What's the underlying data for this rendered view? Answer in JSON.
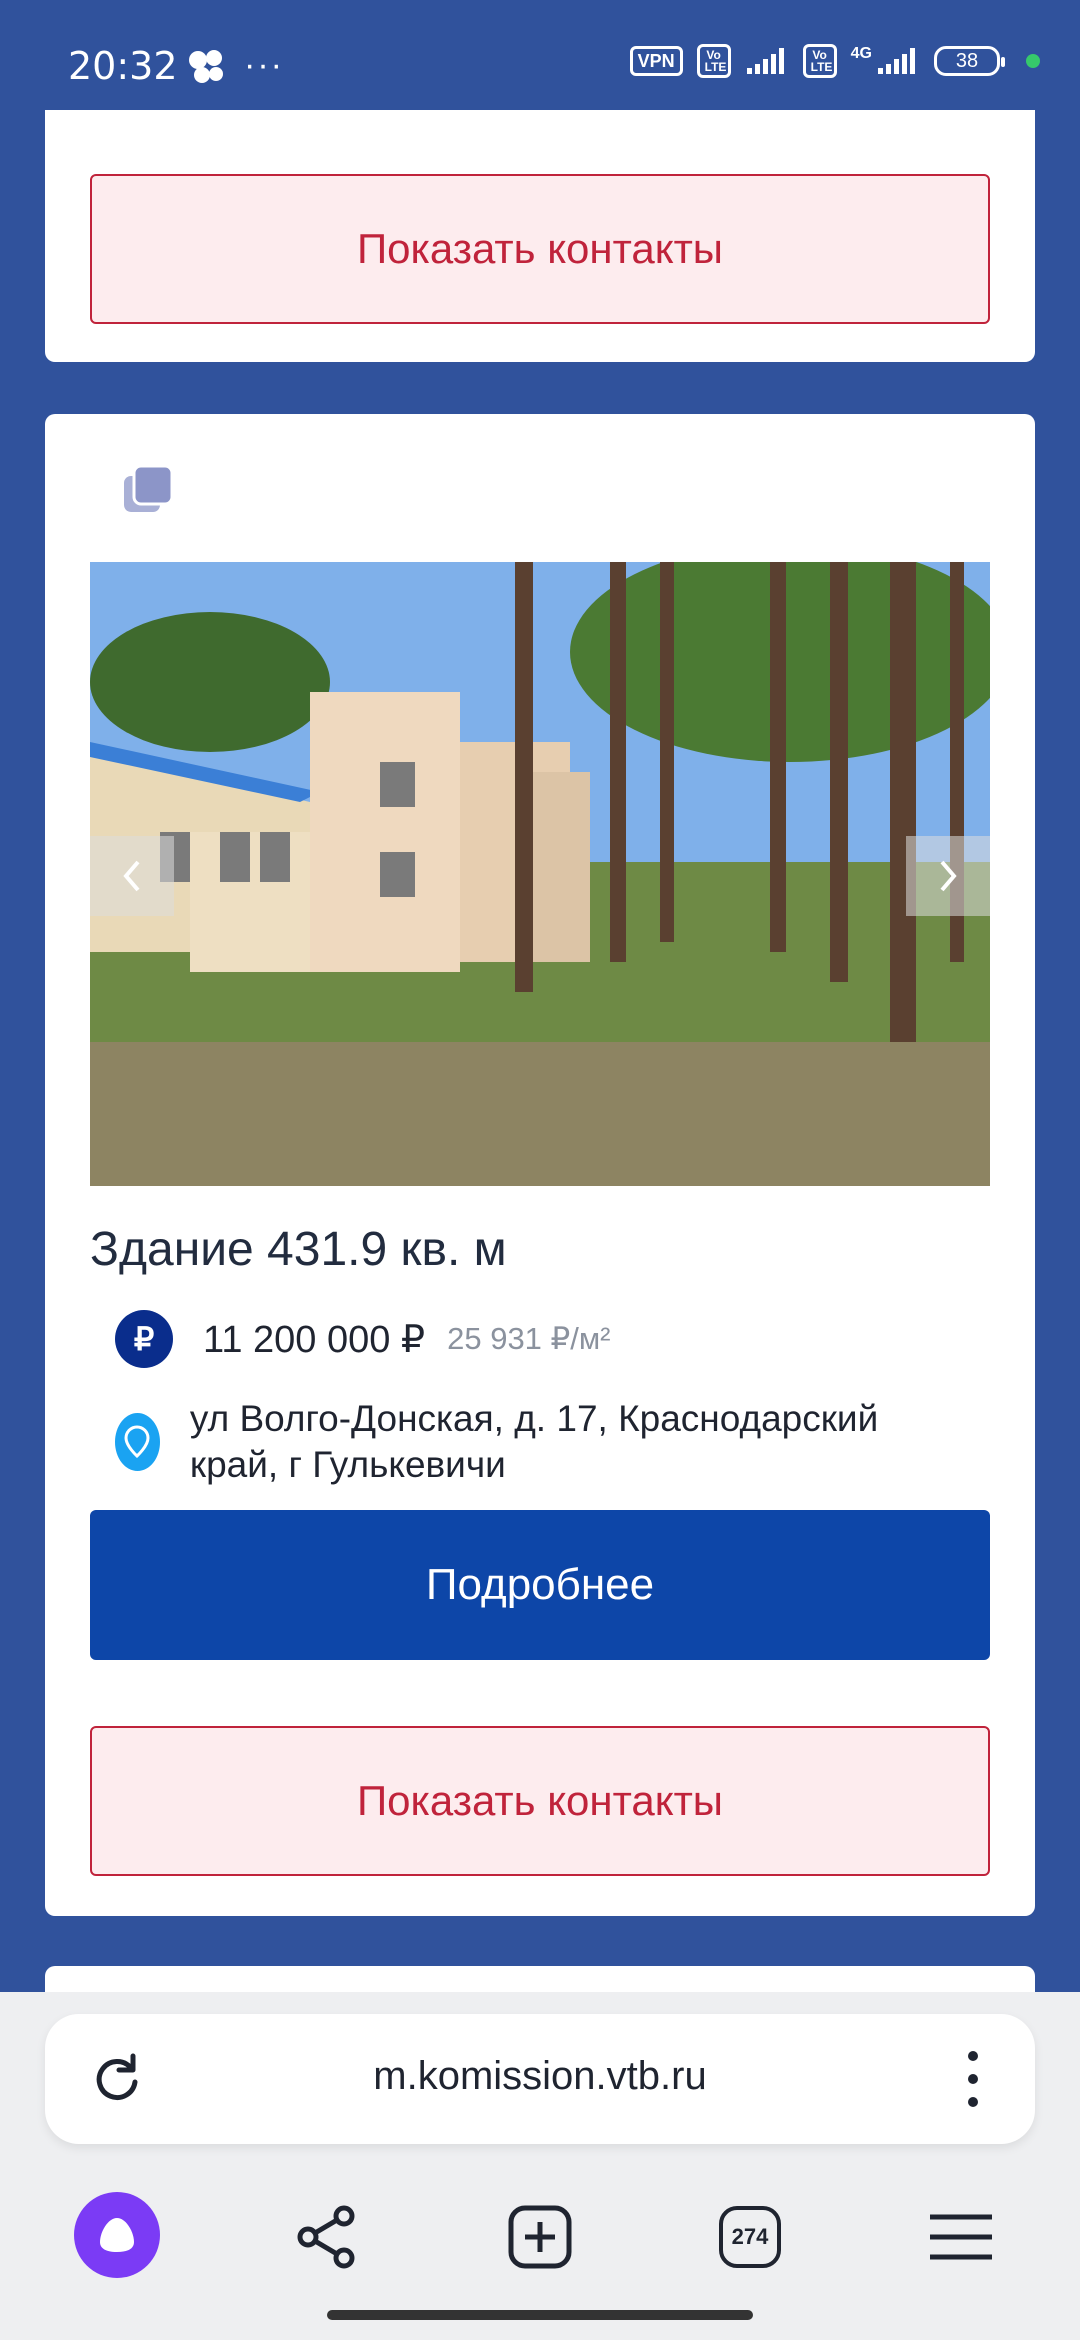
{
  "status_bar": {
    "time": "20:32",
    "dots": "···",
    "vpn": "VPN",
    "volte1": "Vo LTE",
    "volte2": "Vo LTE",
    "network": "4G",
    "battery": "38"
  },
  "card_top": {
    "contacts_label": "Показать контакты"
  },
  "listing": {
    "title": "Здание 431.9 кв. м",
    "price": "11 200 000 ₽",
    "price_per_m2": "25 931 ₽/м²",
    "currency_icon": "₽",
    "address": "ул Волго-Донская, д. 17, Краснодарский край, г Гулькевичи",
    "more_label": "Подробнее",
    "contacts_label": "Показать контакты",
    "photo_alt": "building-photo"
  },
  "browser": {
    "url": "m.komission.vtb.ru",
    "tabs_count": "274"
  },
  "colors": {
    "background": "#30529c",
    "primary_button": "#0d46a8",
    "contacts_border": "#c0233b",
    "alice": "#7b3bf5"
  }
}
